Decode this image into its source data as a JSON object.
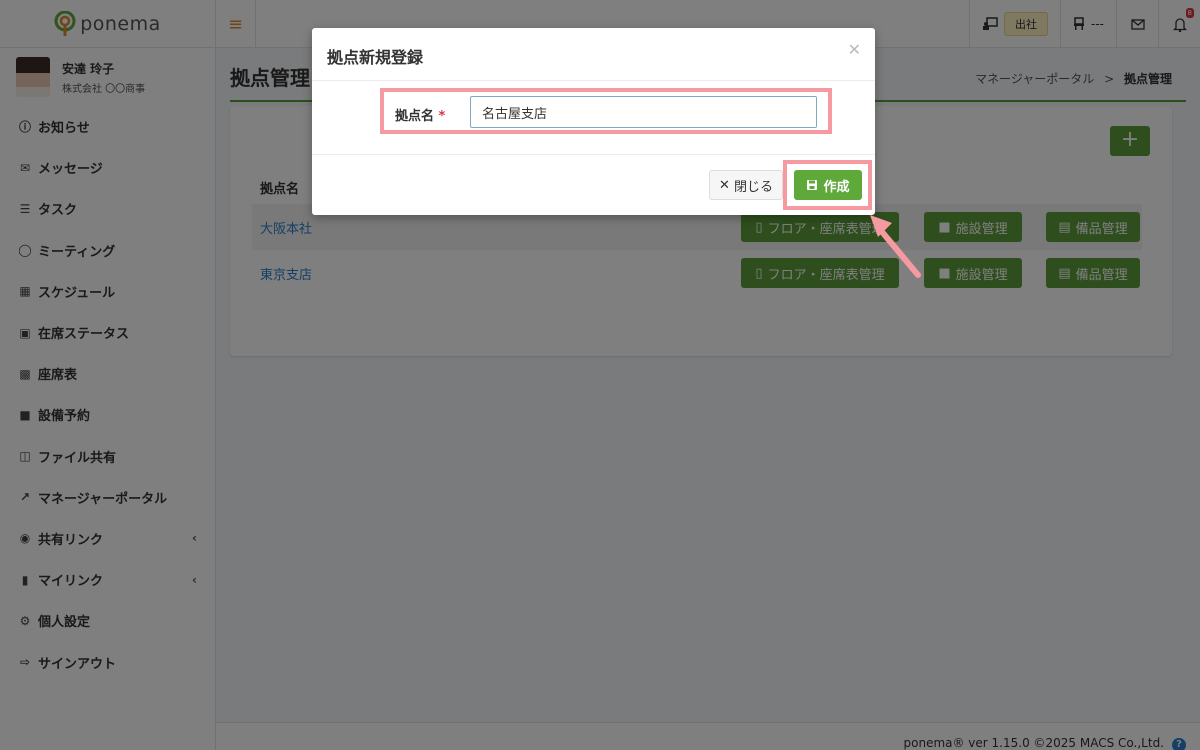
{
  "header": {
    "brand": "ponema",
    "status_label": "出社",
    "seat_label": "---",
    "notification_count": "8"
  },
  "sidebar": {
    "user": {
      "name": "安達 玲子",
      "company": "株式会社 〇〇商事"
    },
    "items": [
      {
        "label": "お知らせ",
        "icon": "info-icon"
      },
      {
        "label": "メッセージ",
        "icon": "mail-icon"
      },
      {
        "label": "タスク",
        "icon": "list-icon"
      },
      {
        "label": "ミーティング",
        "icon": "chat-icon"
      },
      {
        "label": "スケジュール",
        "icon": "calendar-icon"
      },
      {
        "label": "在席ステータス",
        "icon": "presence-icon"
      },
      {
        "label": "座席表",
        "icon": "chair-icon"
      },
      {
        "label": "設備予約",
        "icon": "desk-icon"
      },
      {
        "label": "ファイル共有",
        "icon": "folder-icon"
      },
      {
        "label": "マネージャーポータル",
        "icon": "chart-icon"
      },
      {
        "label": "共有リンク",
        "icon": "globe-icon"
      },
      {
        "label": "マイリンク",
        "icon": "bookmark-icon"
      },
      {
        "label": "個人設定",
        "icon": "gear-icon"
      },
      {
        "label": "サインアウト",
        "icon": "signout-icon"
      }
    ]
  },
  "page": {
    "title": "拠点管理",
    "breadcrumb": {
      "parent": "マネージャーポータル",
      "separator": ">",
      "current": "拠点管理"
    }
  },
  "table": {
    "header": "拠点名",
    "rows": [
      {
        "name": "大阪本社"
      },
      {
        "name": "東京支店"
      }
    ],
    "actions": {
      "floor": "フロア・座席表管理",
      "facility": "施設管理",
      "equipment": "備品管理"
    }
  },
  "modal": {
    "title": "拠点新規登録",
    "field_label": "拠点名",
    "required_mark": "*",
    "field_value": "名古屋支店",
    "close_label": "閉じる",
    "create_label": "作成"
  },
  "footer": {
    "text": "ponema® ver 1.15.0 ©2025 MACS Co.,Ltd."
  },
  "colors": {
    "accent_green": "#5c9e3a",
    "highlight": "#f59aa1",
    "link": "#2a7fcc"
  }
}
